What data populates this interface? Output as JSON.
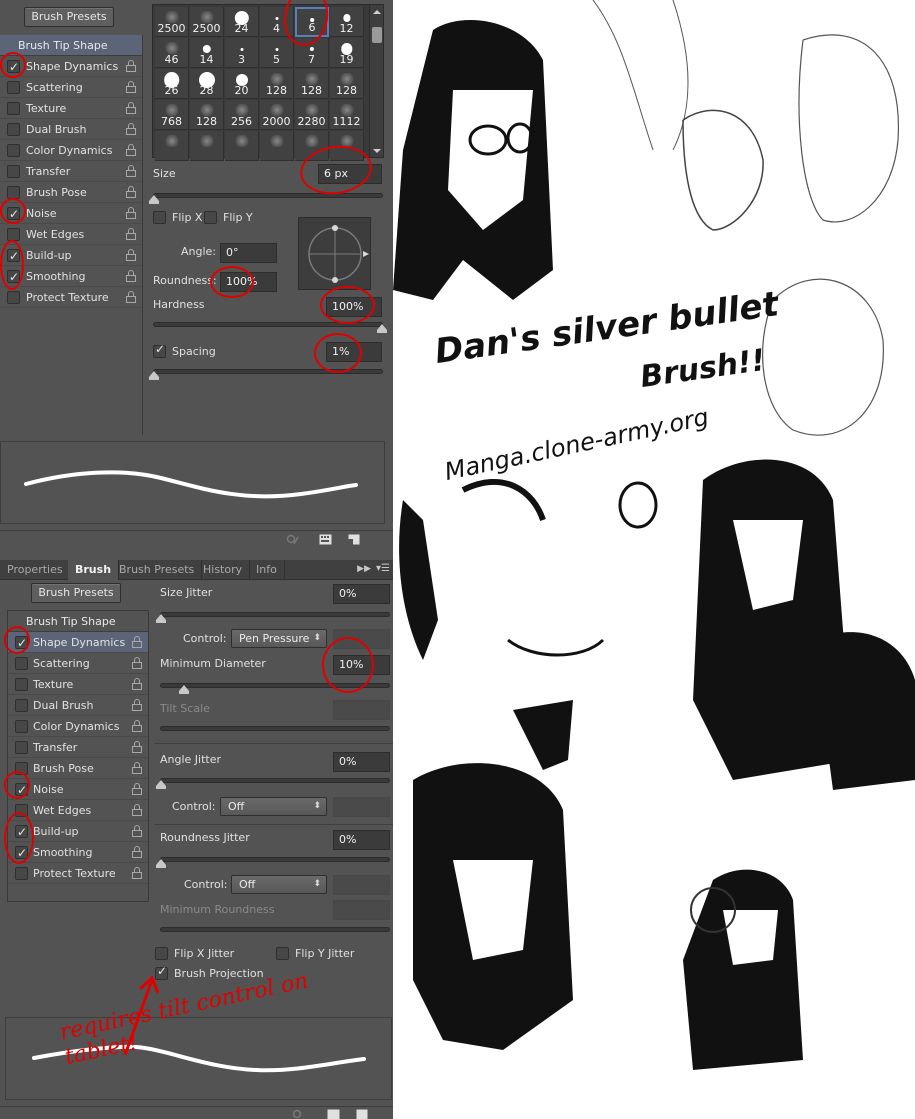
{
  "top_panel": {
    "presets_button": "Brush Presets",
    "list_header": "Brush Tip Shape",
    "list_items": [
      {
        "label": "Shape Dynamics",
        "checked": true
      },
      {
        "label": "Scattering",
        "checked": false
      },
      {
        "label": "Texture",
        "checked": false
      },
      {
        "label": "Dual Brush",
        "checked": false
      },
      {
        "label": "Color Dynamics",
        "checked": false
      },
      {
        "label": "Transfer",
        "checked": false
      },
      {
        "label": "Brush Pose",
        "checked": false
      },
      {
        "label": "Noise",
        "checked": true
      },
      {
        "label": "Wet Edges",
        "checked": false
      },
      {
        "label": "Build-up",
        "checked": true
      },
      {
        "label": "Smoothing",
        "checked": true
      },
      {
        "label": "Protect Texture",
        "checked": false
      }
    ],
    "brush_tiles": [
      {
        "size": "2500",
        "kind": "texture"
      },
      {
        "size": "2500",
        "kind": "texture"
      },
      {
        "size": "24",
        "kind": "round"
      },
      {
        "size": "4",
        "kind": "round"
      },
      {
        "size": "6",
        "kind": "round",
        "selected": true
      },
      {
        "size": "12",
        "kind": "round"
      },
      {
        "size": "46",
        "kind": "texture"
      },
      {
        "size": "14",
        "kind": "round"
      },
      {
        "size": "3",
        "kind": "round"
      },
      {
        "size": "5",
        "kind": "round"
      },
      {
        "size": "7",
        "kind": "round"
      },
      {
        "size": "19",
        "kind": "round"
      },
      {
        "size": "26",
        "kind": "round"
      },
      {
        "size": "28",
        "kind": "round"
      },
      {
        "size": "20",
        "kind": "round"
      },
      {
        "size": "128",
        "kind": "texture"
      },
      {
        "size": "128",
        "kind": "texture"
      },
      {
        "size": "128",
        "kind": "texture"
      },
      {
        "size": "768",
        "kind": "texture"
      },
      {
        "size": "128",
        "kind": "texture"
      },
      {
        "size": "256",
        "kind": "texture"
      },
      {
        "size": "2000",
        "kind": "texture"
      },
      {
        "size": "2280",
        "kind": "texture"
      },
      {
        "size": "1112",
        "kind": "texture"
      },
      {
        "size": "",
        "kind": "texture"
      },
      {
        "size": "",
        "kind": "texture"
      },
      {
        "size": "",
        "kind": "texture"
      },
      {
        "size": "",
        "kind": "texture"
      },
      {
        "size": "",
        "kind": "texture"
      },
      {
        "size": "",
        "kind": "texture"
      }
    ],
    "size_label": "Size",
    "size_value": "6 px",
    "size_slider_fraction": 0.0,
    "flip_x_label": "Flip X",
    "flip_x_checked": false,
    "flip_y_label": "Flip Y",
    "flip_y_checked": false,
    "angle_label": "Angle:",
    "angle_value": "0°",
    "roundness_label": "Roundness:",
    "roundness_value": "100%",
    "hardness_label": "Hardness",
    "hardness_value": "100%",
    "hardness_slider_fraction": 1.0,
    "spacing_label": "Spacing",
    "spacing_checked": true,
    "spacing_value": "1%",
    "spacing_slider_fraction": 0.0
  },
  "bottom_panel": {
    "tabs": [
      "Properties",
      "Brush",
      "Brush Presets",
      "History",
      "Info"
    ],
    "active_tab": "Brush",
    "presets_button": "Brush Presets",
    "list_header": "Brush Tip Shape",
    "list_items": [
      {
        "label": "Shape Dynamics",
        "checked": true,
        "active": true
      },
      {
        "label": "Scattering",
        "checked": false
      },
      {
        "label": "Texture",
        "checked": false
      },
      {
        "label": "Dual Brush",
        "checked": false
      },
      {
        "label": "Color Dynamics",
        "checked": false
      },
      {
        "label": "Transfer",
        "checked": false
      },
      {
        "label": "Brush Pose",
        "checked": false
      },
      {
        "label": "Noise",
        "checked": true
      },
      {
        "label": "Wet Edges",
        "checked": false
      },
      {
        "label": "Build-up",
        "checked": true
      },
      {
        "label": "Smoothing",
        "checked": true
      },
      {
        "label": "Protect Texture",
        "checked": false
      }
    ],
    "size_jitter_label": "Size Jitter",
    "size_jitter_value": "0%",
    "control_label": "Control:",
    "size_control_value": "Pen Pressure",
    "min_diameter_label": "Minimum Diameter",
    "min_diameter_value": "10%",
    "min_diameter_fraction": 0.1,
    "tilt_scale_label": "Tilt Scale",
    "angle_jitter_label": "Angle Jitter",
    "angle_jitter_value": "0%",
    "angle_control_value": "Off",
    "roundness_jitter_label": "Roundness Jitter",
    "roundness_jitter_value": "0%",
    "roundness_control_value": "Off",
    "min_roundness_label": "Minimum Roundness",
    "flip_x_jitter_label": "Flip X Jitter",
    "flip_y_jitter_label": "Flip Y Jitter",
    "brush_projection_label": "Brush Projection",
    "brush_projection_checked": true
  },
  "annotations": {
    "red_note": "requires tilt control on tablet!",
    "color": "#e00000"
  },
  "artwork": {
    "title_line1": "Dan's silver bullet",
    "title_line2": "Brush!!",
    "url": "Manga.clone-army.org"
  }
}
